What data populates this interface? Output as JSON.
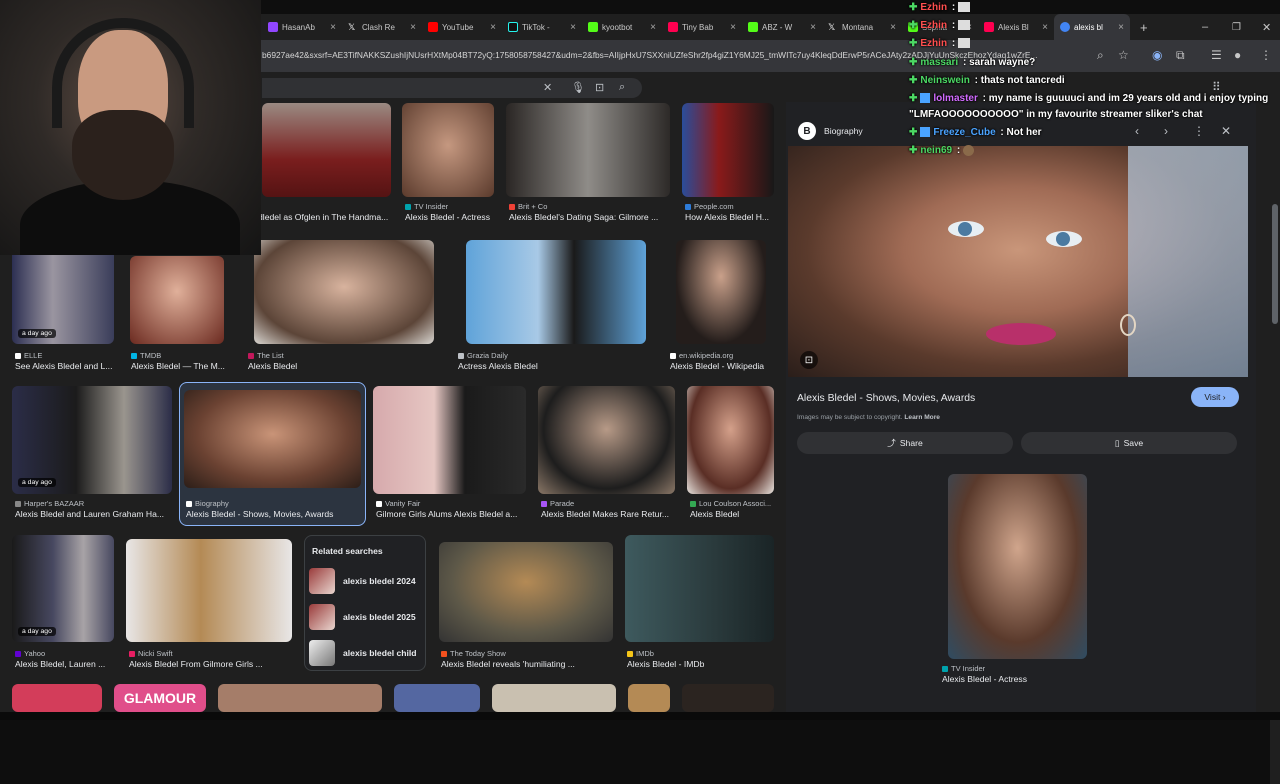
{
  "tabs": [
    {
      "label": "HasanAb",
      "color": "#9146ff"
    },
    {
      "label": "Clash Re",
      "color": "#ffffff"
    },
    {
      "label": "YouTube",
      "color": "#ff0000"
    },
    {
      "label": "TikTok -",
      "color": "#ffffff"
    },
    {
      "label": "kyootbot",
      "color": "#53fc18"
    },
    {
      "label": "Tiny Bab",
      "color": "#ff0050"
    },
    {
      "label": "ABZ - W",
      "color": "#53fc18"
    },
    {
      "label": "Montana",
      "color": "#ffffff"
    },
    {
      "label": "Sophia",
      "color": "#53fc18"
    },
    {
      "label": "Alexis Bl",
      "color": "#ff0050"
    },
    {
      "label": "alexis bl",
      "color": "#4285f4"
    }
  ],
  "address": {
    "url": "b6927ae42&sxsrf=AE3TifNAKKSZushIjNUsrHXtMp04BT72yQ:1758058758427&udm=2&fbs=AIIjpHxU7SXXniUZfeShr2fp4giZ1Y6MJ25_tmWITc7uy4KleqDdErwP5rACeJAty2zADJjYuUnSkczEhozYdaq1wZrE..."
  },
  "grid": [
    {
      "source": "",
      "caption": "dledel as Ofglen in The Handma...",
      "color": "#6b1e1e"
    },
    {
      "source": "TV Insider",
      "caption": "Alexis Bledel - Actress",
      "color": "#8b6a58"
    },
    {
      "source": "Brit + Co",
      "caption": "Alexis Bledel's Dating Saga: Gilmore ...",
      "color": "#2a2624"
    },
    {
      "source": "People.com",
      "caption": "How Alexis Bledel H...",
      "color": "#8a1a1a"
    },
    {
      "source": "ELLE",
      "caption": "See Alexis Bledel and L...",
      "color": "#3a3d5a",
      "badge": "a day ago"
    },
    {
      "source": "TMDB",
      "caption": "Alexis Bledel — The M...",
      "color": "#c98f77"
    },
    {
      "source": "The List",
      "caption": "Alexis Bledel",
      "color": "#9c7d6b"
    },
    {
      "source": "Grazia Daily",
      "caption": "Actress Alexis Bledel",
      "color": "#5fa3d9"
    },
    {
      "source": "en.wikipedia.org",
      "caption": "Alexis Bledel - Wikipedia",
      "color": "#241d1b"
    },
    {
      "source": "Harper's BAZAAR",
      "caption": "Alexis Bledel and Lauren Graham Ha...",
      "color": "#2b2d48",
      "badge": "a day ago"
    },
    {
      "source": "Biography",
      "caption": "Alexis Bledel - Shows, Movies, Awards",
      "color": "#8d6048"
    },
    {
      "source": "Vanity Fair",
      "caption": "Gilmore Girls Alums Alexis Bledel a...",
      "color": "#d6a9ac"
    },
    {
      "source": "Parade",
      "caption": "Alexis Bledel Makes Rare Retur...",
      "color": "#8a7767"
    },
    {
      "source": "Lou Coulson Associ...",
      "caption": "Alexis Bledel",
      "color": "#5a2e25"
    },
    {
      "source": "Yahoo",
      "caption": "Alexis Bledel, Lauren ...",
      "color": "#474860",
      "badge": "a day ago"
    },
    {
      "source": "Nicki Swift",
      "caption": "Alexis Bledel From Gilmore Girls ...",
      "color": "#e8e6e6"
    },
    {
      "source": "The Today Show",
      "caption": "Alexis Bledel reveals 'humiliating ...",
      "color": "#5d5848"
    },
    {
      "source": "IMDb",
      "caption": "Alexis Bledel - IMDb",
      "color": "#2a3a3c"
    }
  ],
  "bottom_thumbs": [
    "#d33d5a",
    "#e04e8a",
    "#a57d69",
    "#5467a1",
    "#c9c0b0",
    "#b48a55",
    "#2b2420"
  ],
  "bottom_labels": [
    "GLAMOUR"
  ],
  "related": {
    "title": "Related searches",
    "items": [
      "alexis bledel 2024",
      "alexis bledel 2025",
      "alexis bledel child"
    ]
  },
  "panel": {
    "source": "Biography",
    "title": "Alexis Bledel - Shows, Movies, Awards",
    "visit": "Visit",
    "copyright": "Images may be subject to copyright.",
    "learn_more": "Learn More",
    "share": "Share",
    "save": "Save",
    "related_source": "TV Insider",
    "related_caption": "Alexis Bledel - Actress"
  },
  "chat": [
    {
      "user": "Ezhin",
      "text": " :",
      "color": "#ff4f4f"
    },
    {
      "user": "Ezhin",
      "text": " :",
      "color": "#ff4f4f"
    },
    {
      "user": "Ezhin",
      "text": " :",
      "color": "#ff4f4f"
    },
    {
      "user": "massari",
      "text": " : sarah wayne?",
      "color": "#4cd964"
    },
    {
      "user": "Neinswein",
      "text": " : thats not tancredi",
      "color": "#4cd964"
    },
    {
      "user": "lolmaster",
      "text": " : my name is guuuuci and im 29 years old and i enjoy typing",
      "color": "#d16bff"
    },
    {
      "user": "",
      "text": "\"LMFAOOOOOOOOOO\" in my favourite streamer sliker's chat",
      "color": "#ffffff"
    },
    {
      "user": "Freeze_Cube",
      "text": " : Not her",
      "color": "#4aa3ff"
    },
    {
      "user": "nein69",
      "text": " :",
      "color": "#4cd964"
    }
  ]
}
